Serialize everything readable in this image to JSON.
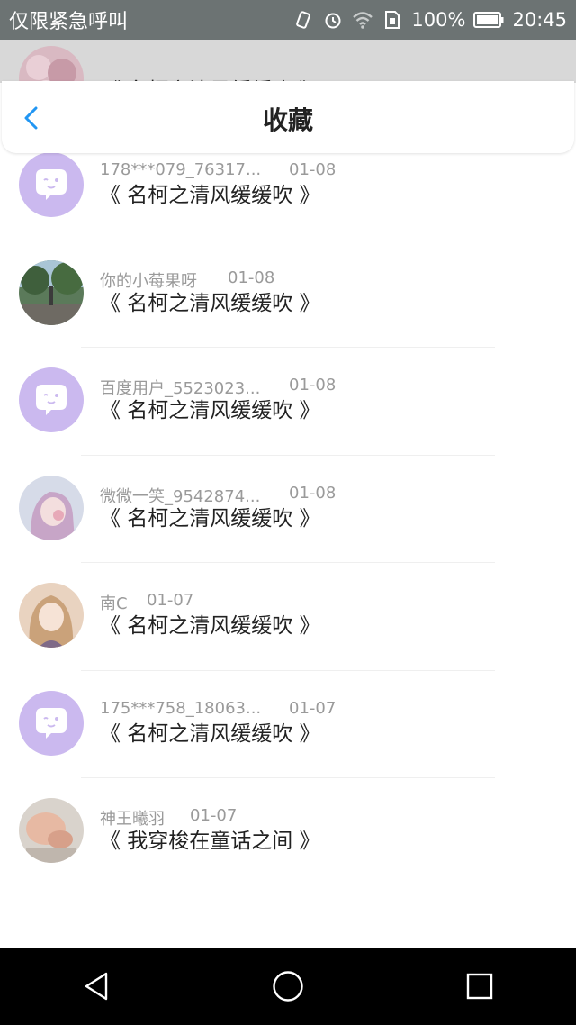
{
  "status_bar": {
    "carrier": "仅限紧急呼叫",
    "battery": "100%",
    "time": "20:45"
  },
  "header": {
    "title": "收藏",
    "back_icon": "chevron-left-icon",
    "accent": "#2196f3"
  },
  "items": [
    {
      "user": "",
      "date": "",
      "title": "《 名柯之清风缓缓吹 》",
      "avatar": "photo"
    },
    {
      "user": "178***079_76317...",
      "date": "01-08",
      "title": "《 名柯之清风缓缓吹 》",
      "avatar": "default"
    },
    {
      "user": "你的小莓果呀",
      "date": "01-08",
      "title": "《 名柯之清风缓缓吹 》",
      "avatar": "photo"
    },
    {
      "user": "百度用户_5523023...",
      "date": "01-08",
      "title": "《 名柯之清风缓缓吹 》",
      "avatar": "default"
    },
    {
      "user": "微微一笑_9542874...",
      "date": "01-08",
      "title": "《 名柯之清风缓缓吹 》",
      "avatar": "photo"
    },
    {
      "user": "南C",
      "date": "01-07",
      "title": "《 名柯之清风缓缓吹 》",
      "avatar": "photo"
    },
    {
      "user": "175***758_18063...",
      "date": "01-07",
      "title": "《 名柯之清风缓缓吹 》",
      "avatar": "default"
    },
    {
      "user": "神王曦羽",
      "date": "01-07",
      "title": "《 我穿梭在童话之间 》",
      "avatar": "photo"
    }
  ],
  "nav": {
    "back_icon": "triangle-back-icon",
    "home_icon": "circle-home-icon",
    "recents_icon": "square-recents-icon"
  }
}
